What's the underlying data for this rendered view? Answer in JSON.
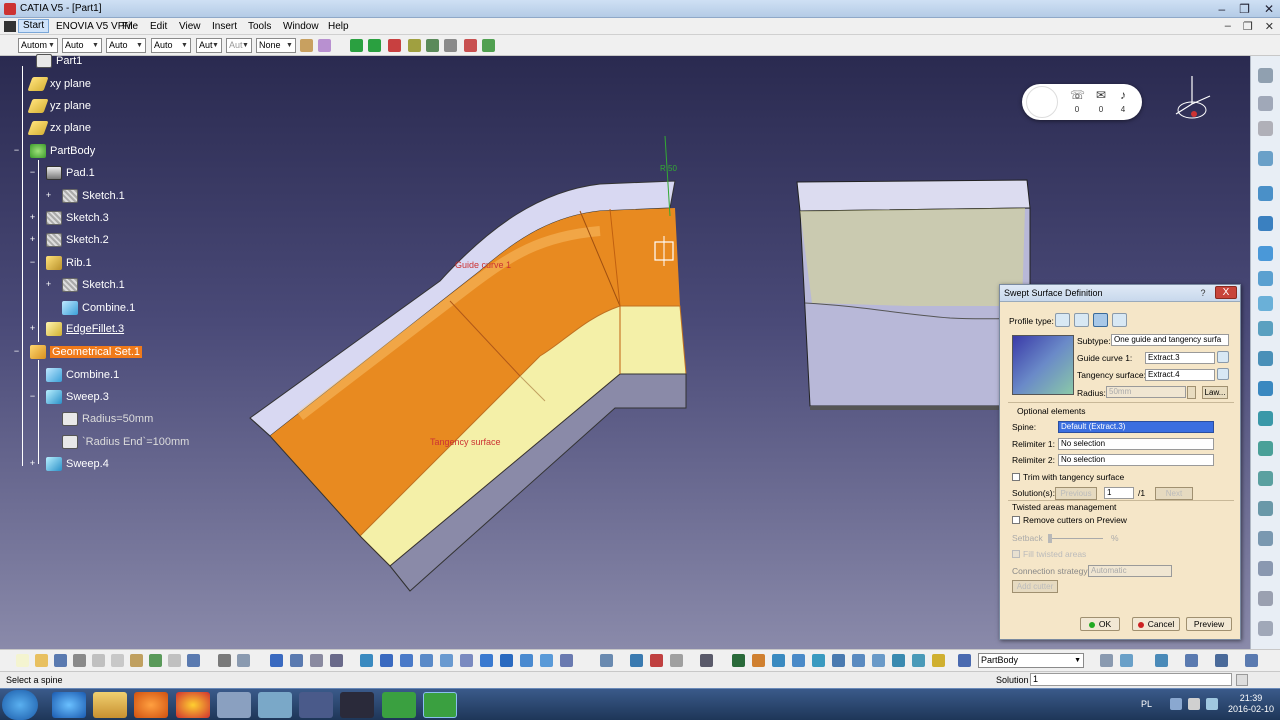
{
  "window": {
    "title": "CATIA V5 - [Part1]"
  },
  "menu": [
    "Start",
    "ENOVIA V5 VPM",
    "File",
    "Edit",
    "View",
    "Insert",
    "Tools",
    "Window",
    "Help"
  ],
  "toolbar1": {
    "combos": [
      "Autom",
      "Auto",
      "Auto",
      "Auto",
      "Aut",
      "Aut",
      "None"
    ]
  },
  "tree": {
    "nodes": [
      {
        "label": "Part1",
        "icon": "part-icon"
      },
      {
        "label": "xy plane",
        "icon": "plane-icon"
      },
      {
        "label": "yz plane",
        "icon": "plane-icon"
      },
      {
        "label": "zx plane",
        "icon": "plane-icon"
      },
      {
        "label": "PartBody",
        "icon": "body-icon"
      },
      {
        "label": "Pad.1",
        "icon": "pad-icon"
      },
      {
        "label": "Sketch.1",
        "icon": "sketch-icon"
      },
      {
        "label": "Sketch.3",
        "icon": "sketch-icon"
      },
      {
        "label": "Sketch.2",
        "icon": "sketch-icon"
      },
      {
        "label": "Rib.1",
        "icon": "rib-icon"
      },
      {
        "label": "Sketch.1",
        "icon": "sketch-icon"
      },
      {
        "label": "Combine.1",
        "icon": "combine-icon"
      },
      {
        "label": "EdgeFillet.3",
        "icon": "fillet-icon"
      },
      {
        "label": "Geometrical Set.1",
        "icon": "geoset-icon"
      },
      {
        "label": "Combine.1",
        "icon": "combine-icon"
      },
      {
        "label": "Sweep.3",
        "icon": "sweep-icon"
      },
      {
        "label": "Radius=50mm",
        "icon": "parameter-icon"
      },
      {
        "label": "`Radius End`=100mm",
        "icon": "parameter-icon"
      },
      {
        "label": "Sweep.4",
        "icon": "sweep-icon"
      }
    ]
  },
  "viewport": {
    "annotations": {
      "guide": "Guide curve 1",
      "tangency": "Tangency surface",
      "radius": "R 50"
    }
  },
  "notifications": {
    "counts": [
      "0",
      "0",
      "4"
    ]
  },
  "dialog": {
    "title": "Swept Surface Definition",
    "help": "?",
    "close": "X",
    "profile_type_label": "Profile type:",
    "subtype_label": "Subtype:",
    "subtype_value": "One guide and tangency surfa",
    "guide_curve_label": "Guide curve 1:",
    "guide_curve_value": "Extract.3",
    "tangency_label": "Tangency surface:",
    "tangency_value": "Extract.4",
    "radius_label": "Radius:",
    "radius_value": "50mm",
    "law_label": "Law...",
    "optional_label": "Optional elements",
    "spine_label": "Spine:",
    "spine_value": "Default (Extract.3)",
    "relimiter1_label": "Relimiter 1:",
    "relimiter1_value": "No selection",
    "relimiter2_label": "Relimiter 2:",
    "relimiter2_value": "No selection",
    "trim_label": "Trim with tangency surface",
    "solutions_label": "Solution(s):",
    "previous_label": "Previous",
    "solution_value": "1",
    "solution_total": "/1",
    "next_label": "Next",
    "twisted_label": "Twisted areas management",
    "remove_cutters_label": "Remove cutters on Preview",
    "setback_label": "Setback",
    "setback_unit": "%",
    "fill_label": "Fill twisted areas",
    "connection_label": "Connection strategy:",
    "connection_value": "Automatic",
    "add_cutter_label": "Add cutter",
    "ok_label": "OK",
    "cancel_label": "Cancel",
    "preview_label": "Preview"
  },
  "toolbar2": {
    "part_combo": "PartBody"
  },
  "status": {
    "message": "Select a spine",
    "solution_label": "Solution",
    "solution_value": "1"
  },
  "taskbar": {
    "lang": "PL",
    "time": "21:39",
    "date": "2016-02-10"
  },
  "colors": {
    "accent_orange": "#f07a1a",
    "surface_orange": "#e88a20",
    "surface_yellow": "#f4f0a8",
    "selection_blue": "#3a6ee0",
    "dialog_bg": "#f5e6c8"
  }
}
